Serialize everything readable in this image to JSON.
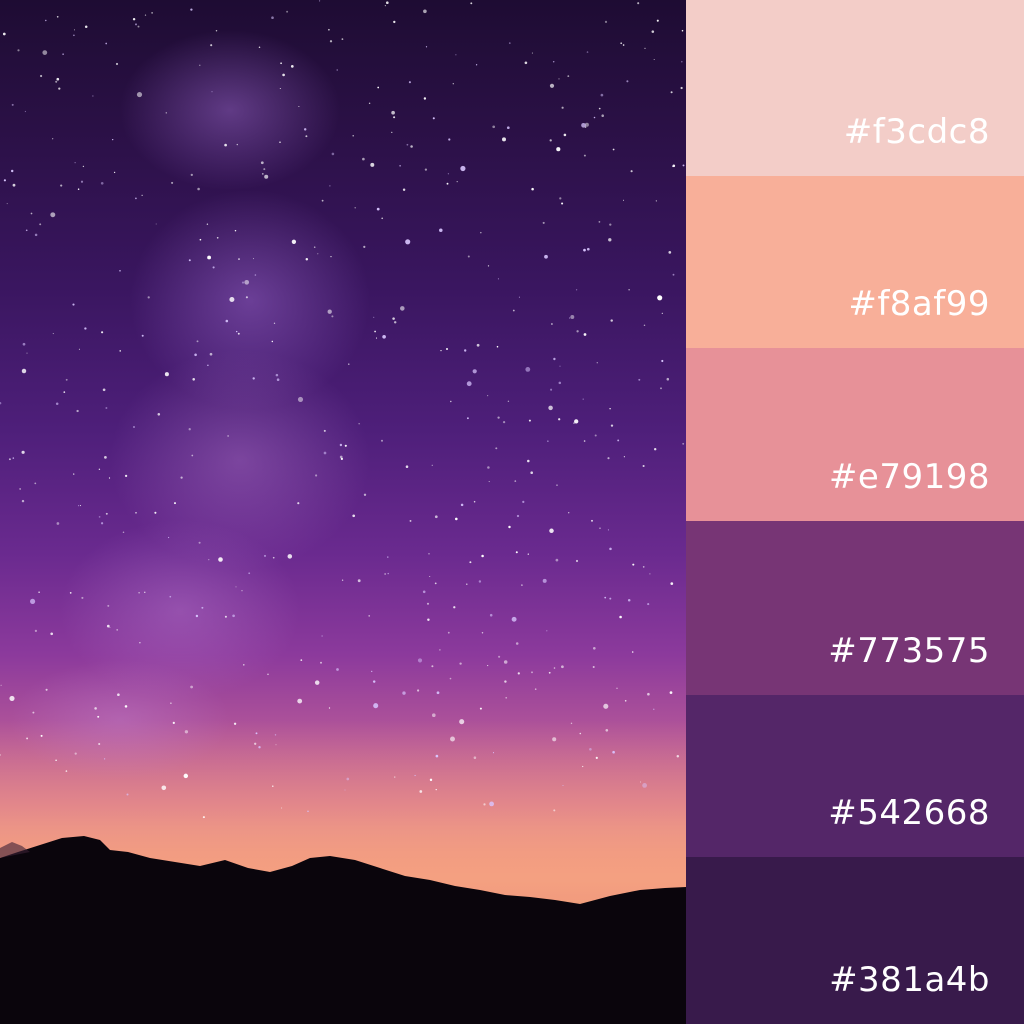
{
  "photo": {
    "subject": "starry-night-sky-over-mountains"
  },
  "palette": {
    "swatches": [
      {
        "code": "#f3cdc8",
        "color": "#f3cdc8"
      },
      {
        "code": "#f8af99",
        "color": "#f8af99"
      },
      {
        "code": "#e79198",
        "color": "#e79198"
      },
      {
        "code": "#773575",
        "color": "#773575"
      },
      {
        "code": "#542668",
        "color": "#542668"
      },
      {
        "code": "#381a4b",
        "color": "#381a4b"
      }
    ]
  }
}
